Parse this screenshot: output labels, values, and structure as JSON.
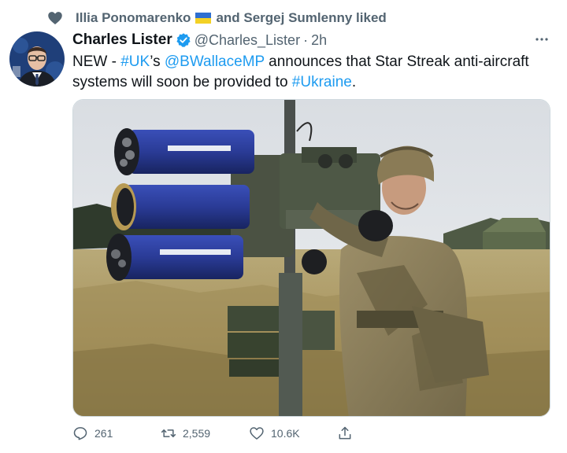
{
  "social_context": {
    "icon": "heart-icon",
    "user1": "Illia Ponomarenko",
    "user1_flag": "ukraine-flag",
    "rest": "and Sergej Sumlenny liked"
  },
  "author": {
    "name": "Charles Lister",
    "verified_icon": "verified-badge-icon",
    "handle": "@Charles_Lister",
    "separator": "·",
    "time": "2h"
  },
  "tweet_text": {
    "part1": "NEW - ",
    "hashtag_uk": "#UK",
    "part2": "’s ",
    "mention": "@BWallaceMP",
    "part3": " announces that Star Streak anti-aircraft systems will soon be provided to ",
    "hashtag_ukraine": "#Ukraine",
    "part4": "."
  },
  "actions": {
    "reply_count": "261",
    "retweet_count": "2,559",
    "like_count": "10.6K"
  },
  "colors": {
    "link": "#1d9bf0",
    "secondary_text": "#536471",
    "primary_text": "#0f1419"
  }
}
